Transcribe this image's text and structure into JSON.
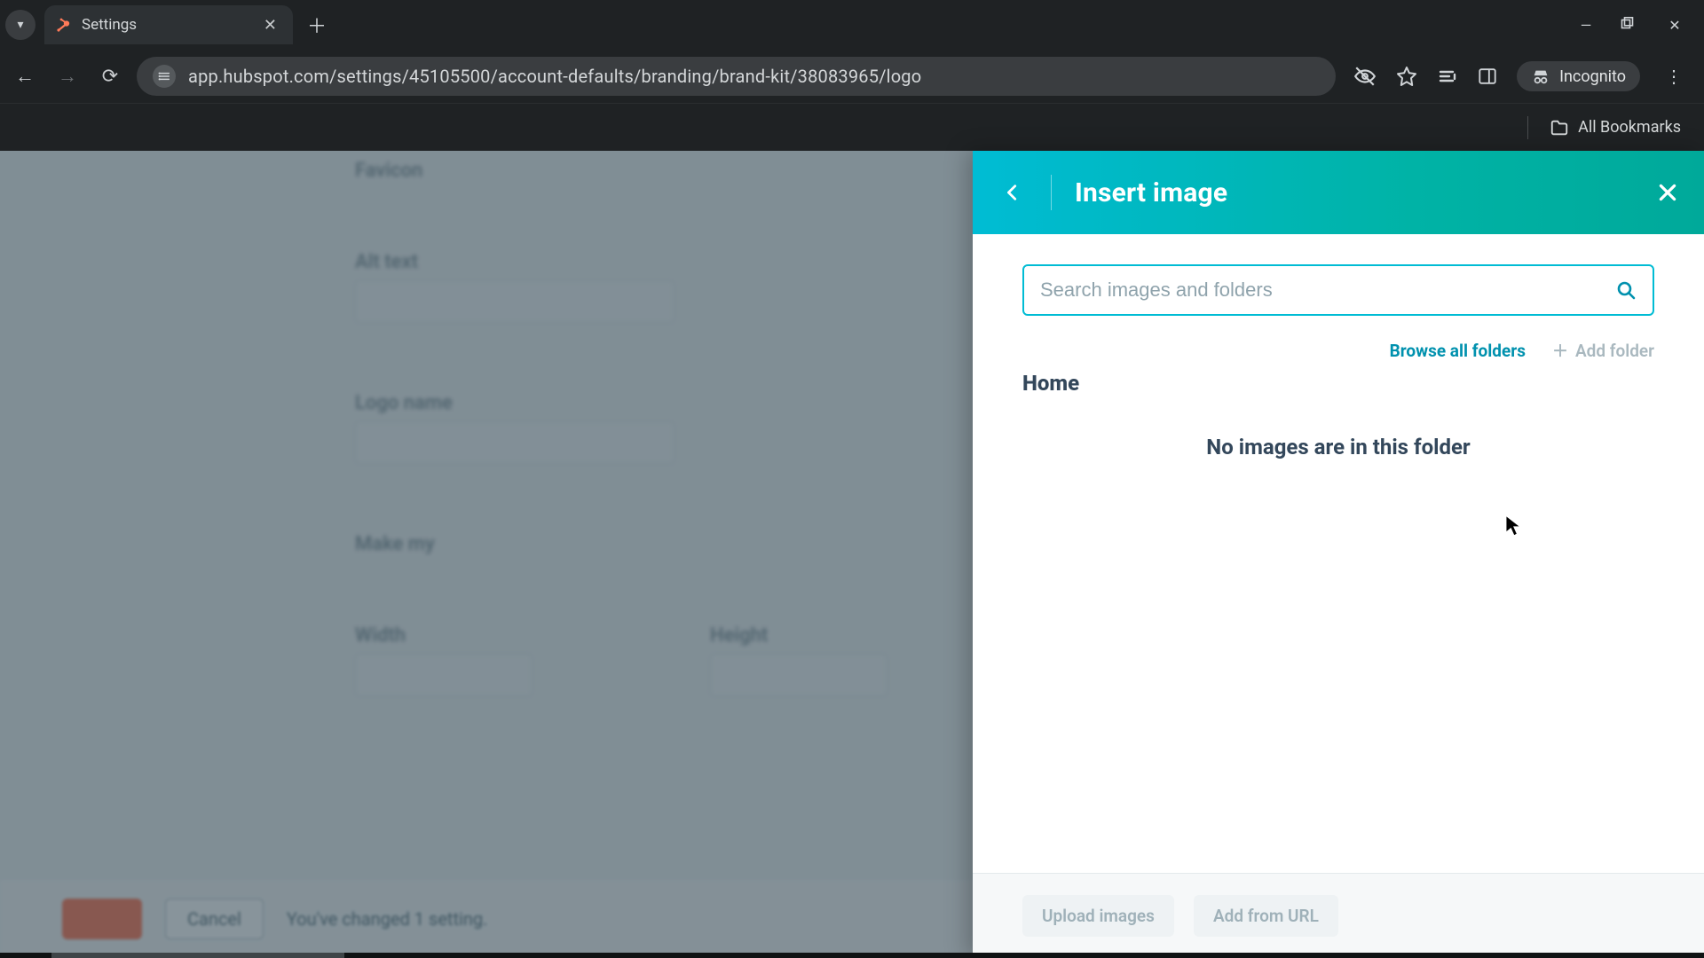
{
  "browser": {
    "tab_title": "Settings",
    "url": "app.hubspot.com/settings/45105500/account-defaults/branding/brand-kit/38083965/logo",
    "incognito_label": "Incognito",
    "all_bookmarks": "All Bookmarks"
  },
  "background": {
    "labels": [
      "Favicon",
      "Alt text",
      "Logo name",
      "Make my",
      "Width",
      "Height"
    ],
    "footer_cancel": "Cancel",
    "footer_msg": "You've changed 1 setting."
  },
  "panel": {
    "title": "Insert image",
    "search_placeholder": "Search images and folders",
    "browse_label": "Browse all folders",
    "add_folder_label": "Add folder",
    "breadcrumb": "Home",
    "empty_msg": "No images are in this folder",
    "upload_label": "Upload images",
    "add_url_label": "Add from URL"
  }
}
